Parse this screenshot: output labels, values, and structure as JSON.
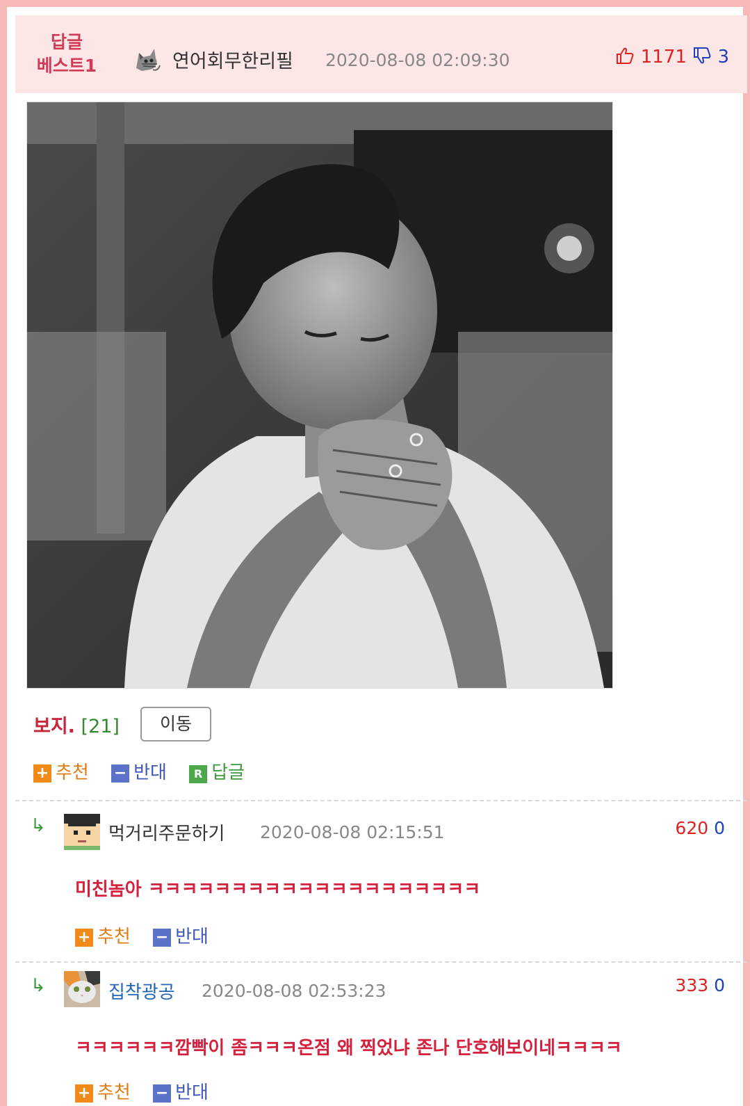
{
  "best": {
    "badge_line1": "답글",
    "badge_line2": "베스트1",
    "nick": "연어회무한리필",
    "date": "2020-08-08 02:09:30",
    "up": "1171",
    "down": "3"
  },
  "post": {
    "boji": "보지.",
    "count": "[21]",
    "move": "이동"
  },
  "actions": {
    "recommend": "추천",
    "oppose": "반대",
    "reply": "답글",
    "reply_icon": "R"
  },
  "replies": [
    {
      "nick": "먹거리주문하기",
      "nick_color": "#333333",
      "date": "2020-08-08 02:15:51",
      "up": "620",
      "down": "0",
      "text": "미친놈아 ㅋㅋㅋㅋㅋㅋㅋㅋㅋㅋㅋㅋㅋㅋㅋㅋㅋㅋㅋㅋ"
    },
    {
      "nick": "집착광공",
      "nick_color": "#2266bb",
      "date": "2020-08-08 02:53:23",
      "up": "333",
      "down": "0",
      "text": "ㅋㅋㅋㅋㅋㅋ깜빡이 좀ㅋㅋㅋ온점 왜 찍었냐 존나 단호해보이네ㅋㅋㅋㅋ"
    }
  ],
  "icons": {
    "reply_arrow": "↳",
    "thumbs_up": "thumbs-up-icon",
    "thumbs_down": "thumbs-down-icon"
  },
  "colors": {
    "frame": "#f7b8b8",
    "header_bg": "#fde6e6",
    "badge": "#d23b57",
    "up": "#dd2222",
    "down": "#1f3fbf"
  }
}
